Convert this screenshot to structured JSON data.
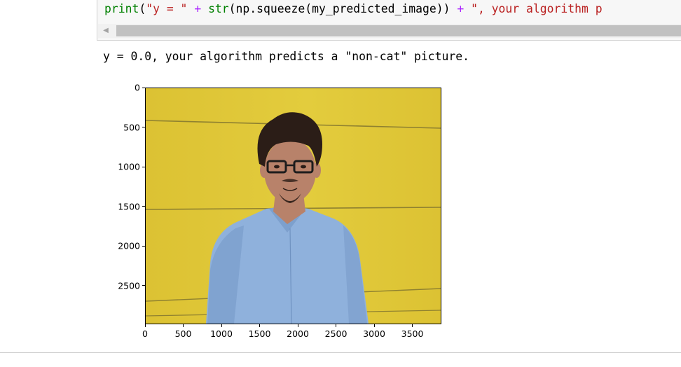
{
  "code": {
    "tokens": [
      {
        "text": "print",
        "kind": "builtin"
      },
      {
        "text": "(",
        "kind": "default"
      },
      {
        "text": "\"y = \"",
        "kind": "str"
      },
      {
        "text": " ",
        "kind": "default"
      },
      {
        "text": "+",
        "kind": "op"
      },
      {
        "text": " ",
        "kind": "default"
      },
      {
        "text": "str",
        "kind": "builtin"
      },
      {
        "text": "(np.squeeze(my_predicted_image))",
        "kind": "default"
      },
      {
        "text": " ",
        "kind": "default"
      },
      {
        "text": "+",
        "kind": "op"
      },
      {
        "text": " ",
        "kind": "default"
      },
      {
        "text": "\", your algorithm p",
        "kind": "str"
      }
    ],
    "colors": {
      "builtin": "#008000",
      "default": "#000000",
      "op": "#aa22ff",
      "str": "#ba2121"
    }
  },
  "output": {
    "text": "y = 0.0, your algorithm predicts a \"non-cat\" picture."
  },
  "chart_data": {
    "type": "image",
    "xlim": [
      0,
      3880
    ],
    "ylim": [
      2990,
      0
    ],
    "x_ticks": [
      0,
      500,
      1000,
      1500,
      2000,
      2500,
      3000,
      3500
    ],
    "y_ticks": [
      0,
      500,
      1000,
      1500,
      2000,
      2500
    ],
    "x_tick_labels": [
      "0",
      "500",
      "1000",
      "1500",
      "2000",
      "2500",
      "3000",
      "3500"
    ],
    "y_tick_labels": [
      "0",
      "500",
      "1000",
      "1500",
      "2000",
      "2500"
    ]
  },
  "photo": {
    "colors": {
      "wall": "#dcc233",
      "wall_light": "#e3cc3d",
      "line": "#8f8130",
      "shirt": "#8fb1dc",
      "shirt_dark": "#6f92c1",
      "skin": "#b8826a",
      "hair": "#2b1d17",
      "glasses": "#1c1c1c"
    }
  }
}
